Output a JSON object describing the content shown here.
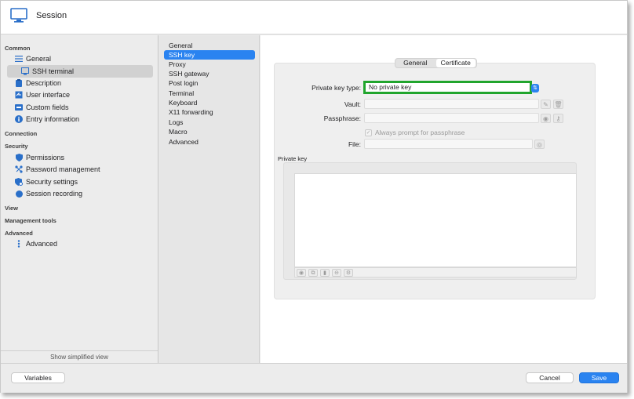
{
  "window": {
    "title": "Session",
    "title_icon": "monitor-icon"
  },
  "sidebar": {
    "sections": {
      "common": "Common",
      "connection": "Connection",
      "security": "Security",
      "view": "View",
      "management_tools": "Management tools",
      "advanced": "Advanced"
    },
    "items": [
      {
        "label": "General",
        "icon": "list-icon"
      },
      {
        "label": "SSH terminal",
        "icon": "terminal-icon"
      },
      {
        "label": "Description",
        "icon": "clipboard-icon"
      },
      {
        "label": "User interface",
        "icon": "window-icon"
      },
      {
        "label": "Custom fields",
        "icon": "fields-icon"
      },
      {
        "label": "Entry information",
        "icon": "info-icon"
      },
      {
        "label": "Permissions",
        "icon": "shield-icon"
      },
      {
        "label": "Password management",
        "icon": "network-icon"
      },
      {
        "label": "Security settings",
        "icon": "settings-shield-icon"
      },
      {
        "label": "Session recording",
        "icon": "record-icon"
      },
      {
        "label": "Advanced",
        "icon": "dots-icon"
      }
    ],
    "footer": "Show simplified view"
  },
  "middle": {
    "items": [
      "General",
      "SSH key",
      "Proxy",
      "SSH gateway",
      "Post login",
      "Terminal",
      "Keyboard",
      "X11 forwarding",
      "Logs",
      "Macro",
      "Advanced"
    ],
    "selected": "SSH key"
  },
  "content": {
    "tabs": [
      "General",
      "Certificate"
    ],
    "selected_tab": "Certificate",
    "form": {
      "private_key_type_label": "Private key type:",
      "private_key_type_value": "No private key",
      "vault_label": "Vault:",
      "vault_value": "",
      "passphrase_label": "Passphrase:",
      "passphrase_value": "",
      "always_prompt_label": "Always prompt for passphrase",
      "always_prompt_checked": true,
      "file_label": "File:",
      "file_value": ""
    },
    "private_key_section": "Private key",
    "private_key_text": ""
  },
  "bottom": {
    "variables": "Variables",
    "cancel": "Cancel",
    "save": "Save"
  },
  "colors": {
    "accent": "#2a83f0",
    "highlight": "#21a52d"
  }
}
